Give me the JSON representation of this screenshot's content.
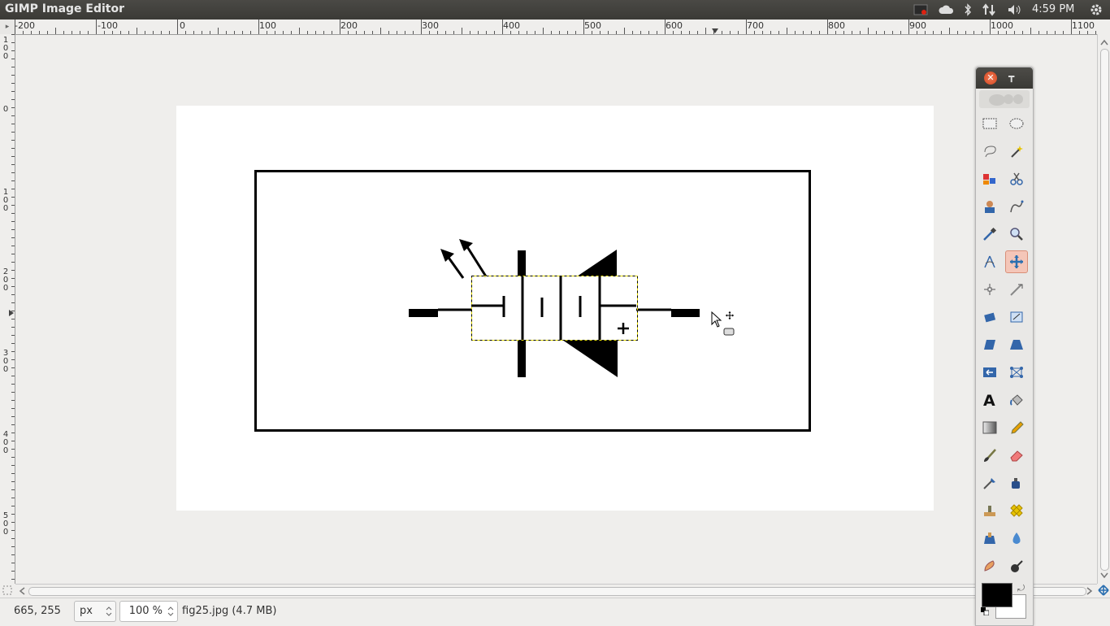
{
  "topbar": {
    "app_title": "GIMP Image Editor",
    "clock": "4:59 PM",
    "tray_icons": [
      "record-icon",
      "cloud-icon",
      "bluetooth-icon",
      "network-icon",
      "volume-icon",
      "settings-icon"
    ]
  },
  "rulers": {
    "horizontal_labels": [
      "-200",
      "-100",
      "0",
      "100",
      "200",
      "300",
      "400",
      "500",
      "600",
      "700",
      "800",
      "900",
      "1000",
      "1100"
    ],
    "vertical_labels": [
      "100",
      "0",
      "100",
      "200",
      "300",
      "400",
      "500"
    ]
  },
  "status": {
    "coords": "665, 255",
    "unit": "px",
    "zoom": "100 %",
    "file_info": "fig25.jpg (4.7 MB)"
  },
  "toolbox": {
    "tools": [
      "rect-select-icon",
      "ellipse-select-icon",
      "free-select-icon",
      "fuzzy-select-icon",
      "color-select-icon",
      "scissors-icon",
      "foreground-select-icon",
      "paths-icon",
      "color-picker-icon",
      "zoom-icon",
      "measure-icon",
      "move-icon",
      "align-icon",
      "crop-icon",
      "rotate-icon",
      "scale-icon",
      "shear-icon",
      "perspective-icon",
      "flip-icon",
      "cage-icon",
      "text-icon",
      "bucket-fill-icon",
      "blend-icon",
      "pencil-icon",
      "paintbrush-icon",
      "eraser-icon",
      "airbrush-icon",
      "ink-icon",
      "clone-icon",
      "heal-icon",
      "perspective-clone-icon",
      "blur-icon",
      "smudge-icon",
      "dodge-burn-icon"
    ],
    "active_tool": "move-icon",
    "foreground_color": "#000000",
    "background_color": "#ffffff"
  }
}
